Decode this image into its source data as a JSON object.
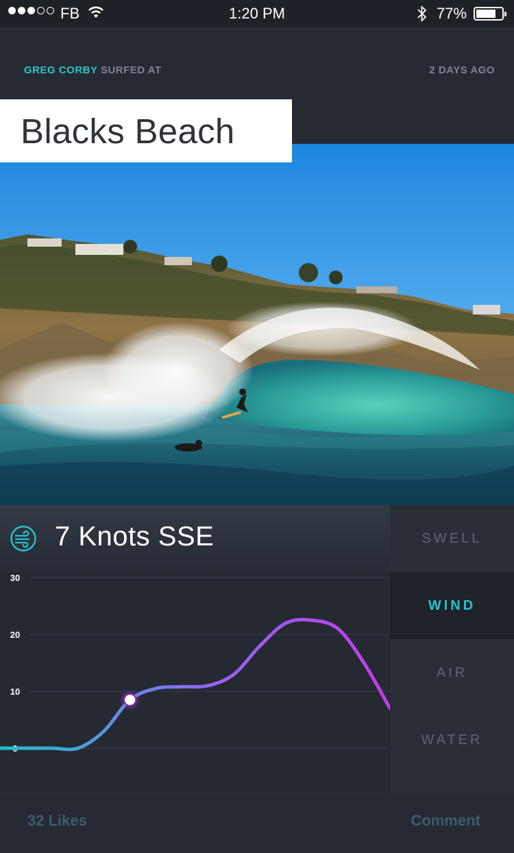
{
  "status_bar": {
    "carrier": "FB",
    "time": "1:20 PM",
    "battery_percent": "77%",
    "battery_level": 0.77,
    "signal_bars_filled": 3,
    "signal_bars_total": 5
  },
  "post": {
    "user": "GREG CORBY",
    "action": "SURFED AT",
    "time_ago": "2 DAYS AGO",
    "spot": "Blacks Beach"
  },
  "conditions": {
    "reading": "7 Knots SSE",
    "icon": "wind-icon",
    "tabs": [
      {
        "label": "SWELL",
        "active": false
      },
      {
        "label": "WIND",
        "active": true
      },
      {
        "label": "AIR",
        "active": false
      },
      {
        "label": "WATER",
        "active": false
      }
    ]
  },
  "chart_data": {
    "type": "line",
    "y_ticks": [
      "30",
      "20",
      "10",
      "0"
    ],
    "ylim": [
      0,
      30
    ],
    "grid": true,
    "highlight_index": 5,
    "series": [
      {
        "x": [
          0,
          1,
          2,
          3,
          4,
          5,
          6,
          7,
          8,
          9,
          10,
          11,
          12,
          13,
          14,
          15
        ],
        "values": [
          0,
          0,
          0,
          0,
          3,
          8.5,
          10.5,
          10.8,
          11,
          13,
          18,
          22,
          22.5,
          21,
          15,
          7
        ],
        "gradient": [
          "#1fc1c7",
          "#8b6bf0",
          "#c13ce8"
        ]
      }
    ]
  },
  "footer": {
    "likes": "32 Likes",
    "comment": "Comment"
  },
  "colors": {
    "accent": "#25c4cc",
    "background": "#262a33"
  }
}
